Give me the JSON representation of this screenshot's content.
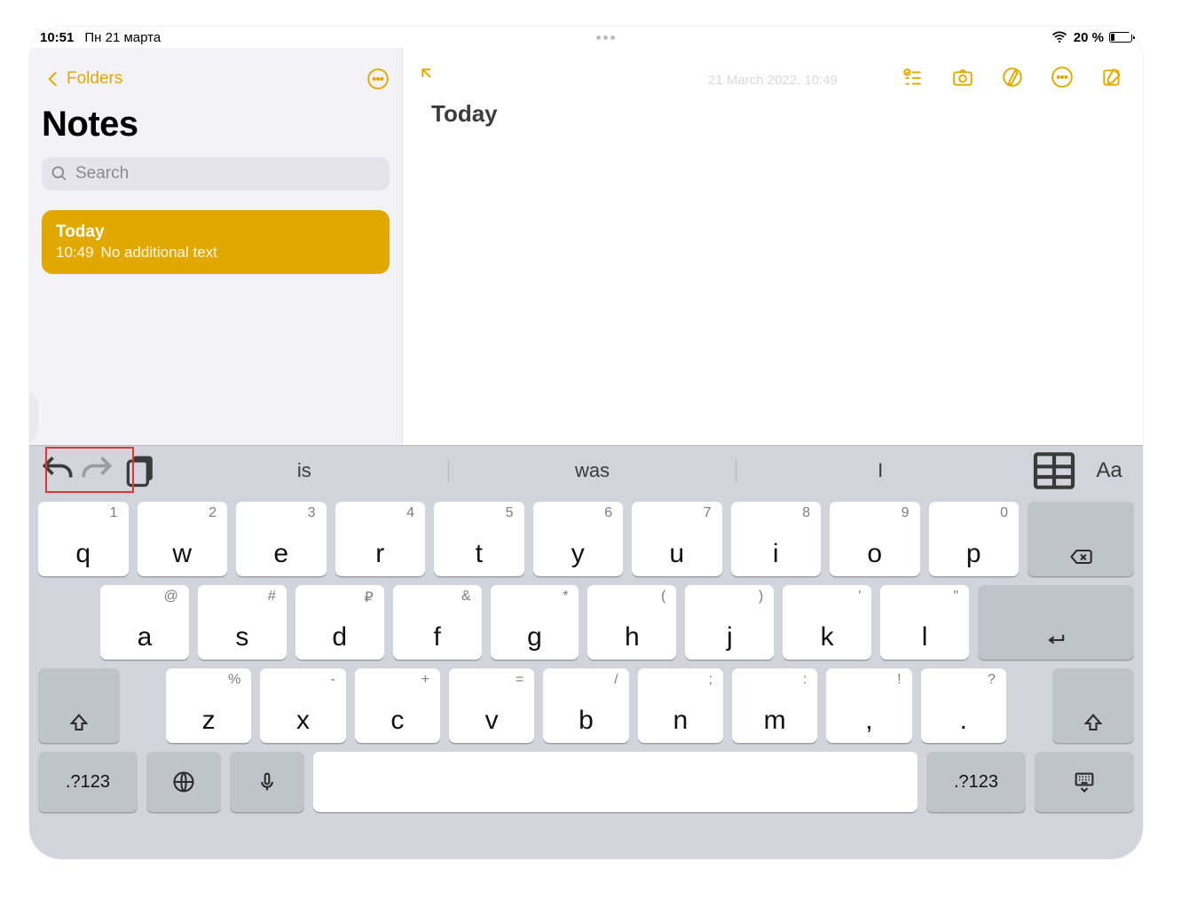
{
  "statusbar": {
    "time": "10:51",
    "date": "Пн 21 марта",
    "battery_pct": "20 %"
  },
  "sidebar": {
    "back_label": "Folders",
    "title": "Notes",
    "search_placeholder": "Search",
    "note": {
      "title": "Today",
      "time": "10:49",
      "preview": "No additional text"
    }
  },
  "editor": {
    "timestamp": "21 March 2022, 10:49",
    "content": "Today"
  },
  "keyboard": {
    "suggestions": [
      "is",
      "was",
      "I"
    ],
    "row1_hints": [
      "1",
      "2",
      "3",
      "4",
      "5",
      "6",
      "7",
      "8",
      "9",
      "0"
    ],
    "row1": [
      "q",
      "w",
      "e",
      "r",
      "t",
      "y",
      "u",
      "i",
      "o",
      "p"
    ],
    "row2_hints": [
      "@",
      "#",
      "₽",
      "&",
      "*",
      "(",
      ")",
      "'",
      "\""
    ],
    "row2": [
      "a",
      "s",
      "d",
      "f",
      "g",
      "h",
      "j",
      "k",
      "l"
    ],
    "row3_hints": [
      "%",
      "-",
      "+",
      "=",
      "/",
      ";",
      ":",
      "!",
      "?"
    ],
    "row3": [
      "z",
      "x",
      "c",
      "v",
      "b",
      "n",
      "m",
      ",",
      "."
    ],
    "sym_label": ".?123"
  }
}
